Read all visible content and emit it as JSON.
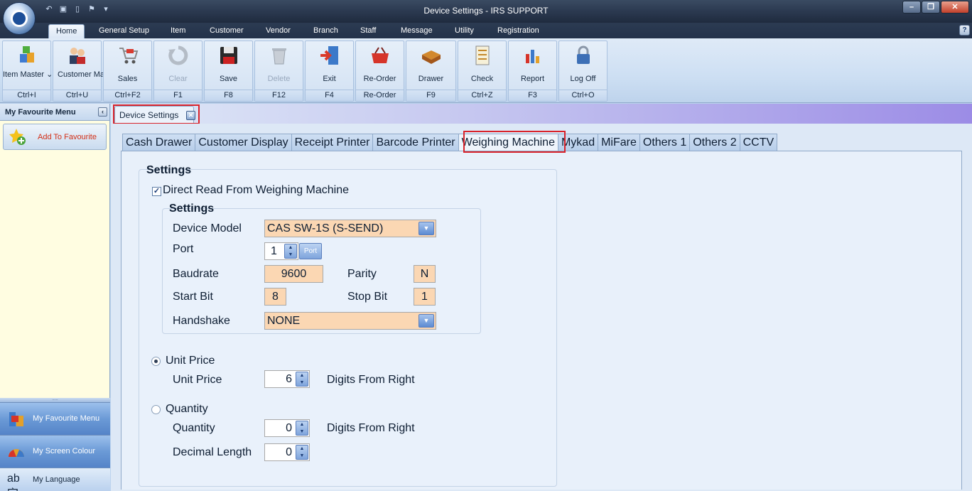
{
  "window": {
    "title": "Device Settings - IRS SUPPORT"
  },
  "ribbon_tabs": [
    "Home",
    "General Setup",
    "Item",
    "Customer",
    "Vendor",
    "Branch",
    "Staff",
    "Message",
    "Utility",
    "Registration"
  ],
  "ribbon_buttons": [
    {
      "label": "Item Master ⌄",
      "shortcut": "Ctrl+I"
    },
    {
      "label": "Customer Master ⌄",
      "shortcut": "Ctrl+U"
    },
    {
      "label": "Sales",
      "shortcut": "Ctrl+F2"
    },
    {
      "label": "Clear",
      "shortcut": "F1"
    },
    {
      "label": "Save",
      "shortcut": "F8"
    },
    {
      "label": "Delete",
      "shortcut": "F12"
    },
    {
      "label": "Exit",
      "shortcut": "F4"
    },
    {
      "label": "Re-Order",
      "shortcut": "Re-Order"
    },
    {
      "label": "Drawer",
      "shortcut": "F9"
    },
    {
      "label": "Check",
      "shortcut": "Ctrl+Z"
    },
    {
      "label": "Report",
      "shortcut": "F3"
    },
    {
      "label": "Log Off",
      "shortcut": "Ctrl+O"
    }
  ],
  "left_panel": {
    "title": "My Favourite Menu",
    "add_favourite": "Add To Favourite",
    "nav": [
      "My Favourite Menu",
      "My Screen Colour",
      "My Language"
    ]
  },
  "document_tab": {
    "label": "Device Settings"
  },
  "settings_tabs": [
    "Cash Drawer",
    "Customer Display",
    "Receipt Printer",
    "Barcode Printer",
    "Weighing Machine",
    "Mykad",
    "MiFare",
    "Others 1",
    "Others 2",
    "CCTV"
  ],
  "active_settings_tab": "Weighing Machine",
  "weighing": {
    "group_title": "Settings",
    "direct_read_label": "Direct Read From Weighing Machine",
    "direct_read_checked": true,
    "inner_title": "Settings",
    "device_model_label": "Device Model",
    "device_model_value": "CAS SW-1S (S-SEND)",
    "port_label": "Port",
    "port_value": "1",
    "port_button": "Port",
    "baudrate_label": "Baudrate",
    "baudrate_value": "9600",
    "parity_label": "Parity",
    "parity_value": "N",
    "start_bit_label": "Start Bit",
    "start_bit_value": "8",
    "stop_bit_label": "Stop Bit",
    "stop_bit_value": "1",
    "handshake_label": "Handshake",
    "handshake_value": "NONE",
    "unit_price_radio": "Unit Price",
    "unit_price_selected": true,
    "unit_price_label": "Unit Price",
    "unit_price_value": "6",
    "digits_from_right": "Digits From Right",
    "quantity_radio": "Quantity",
    "quantity_label": "Quantity",
    "quantity_value": "0",
    "decimal_length_label": "Decimal Length",
    "decimal_length_value": "0"
  },
  "colors": {
    "input_bg": "#fbd7b3",
    "highlight_red": "#d9222a",
    "title_bar": "#2b3950"
  }
}
